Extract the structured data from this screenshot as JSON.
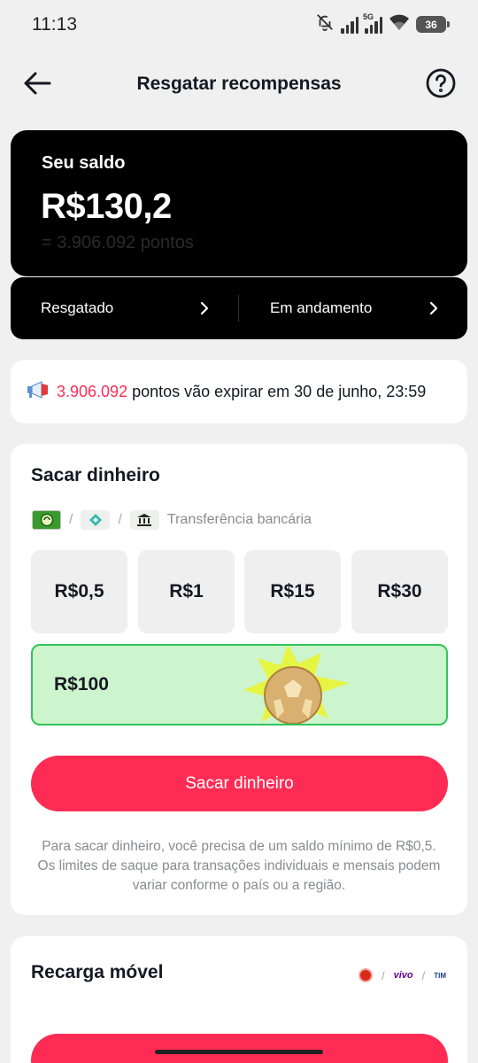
{
  "status_bar": {
    "time": "11:13",
    "network": "5G",
    "battery": "36",
    "icons": [
      "bell-off-icon",
      "signal-icon",
      "signal-5g-icon",
      "wifi-icon",
      "battery-icon"
    ]
  },
  "nav": {
    "title": "Resgatar recompensas",
    "back_icon": "arrow-left-icon",
    "help_icon": "help-circle-icon"
  },
  "balance": {
    "label": "Seu saldo",
    "amount": "R$130,2",
    "points": "= 3.906.092 pontos",
    "links": [
      {
        "label": "Resgatado",
        "icon": "chevron-right-icon"
      },
      {
        "label": "Em andamento",
        "icon": "chevron-right-icon"
      }
    ]
  },
  "notice": {
    "icon": "megaphone-icon",
    "points": "3.906.092",
    "text": "pontos vão expirar em 30 de junho, 23:59"
  },
  "cash": {
    "title": "Sacar dinheiro",
    "methods": [
      "pix-app-icon",
      "pix-icon",
      "bank-icon"
    ],
    "bank_transfer_label": "Transferência bancária",
    "separator": "/",
    "amounts": [
      "R$0,5",
      "R$1",
      "R$15",
      "R$30"
    ],
    "selected_amount": "R$100",
    "button_label": "Sacar dinheiro",
    "info": "Para sacar dinheiro, você precisa de um saldo mínimo de R$0,5. Os limites de saque para transações individuais e mensais podem variar conforme o país ou a região."
  },
  "recharge": {
    "title": "Recarga móvel",
    "operators": [
      "claro-logo",
      "vivo",
      "TIM"
    ]
  },
  "colors": {
    "accent": "#fe2c55",
    "selected_bg": "#cdf5cd",
    "selected_border": "#33c35b",
    "card_dark": "#000000"
  }
}
